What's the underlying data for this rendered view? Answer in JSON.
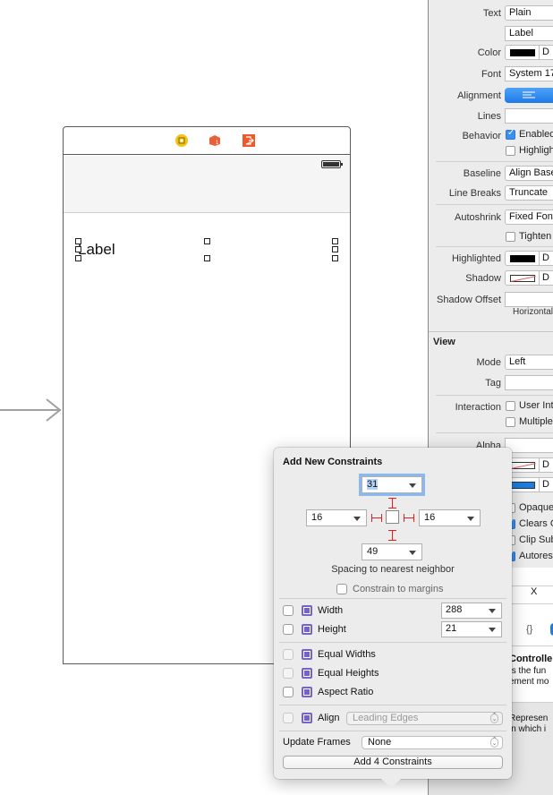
{
  "canvas": {
    "scene_label": "Label",
    "dock_icons": [
      "view-controller-icon",
      "first-responder-icon",
      "exit-icon"
    ],
    "colors": {
      "vc_icon": "#f3c316",
      "responder_icon": "#e8603a",
      "exit_icon": "#ee5b2b"
    }
  },
  "inspector": {
    "rows": [
      {
        "label": "Text",
        "value": "Plain"
      },
      {
        "label": "",
        "value": "Label"
      },
      {
        "label": "Color",
        "value": "D"
      },
      {
        "label": "Font",
        "value": "System 17"
      },
      {
        "label": "Alignment",
        "value": ""
      },
      {
        "label": "Lines",
        "value": ""
      },
      {
        "label": "Behavior",
        "value": "Enabled",
        "checked": true
      },
      {
        "label": "",
        "value": "Highlighted",
        "checked": false
      },
      {
        "label": "Baseline",
        "value": "Align Baselines"
      },
      {
        "label": "Line Breaks",
        "value": "Truncate"
      },
      {
        "label": "Autoshrink",
        "value": "Fixed Font"
      },
      {
        "label": "",
        "value": "Tighten",
        "checked": false
      },
      {
        "label": "Highlighted",
        "value": "D"
      },
      {
        "label": "Shadow",
        "value": "D"
      },
      {
        "label": "Shadow Offset",
        "value": ""
      },
      {
        "label": "",
        "value": "Horizontal"
      }
    ],
    "view_section": {
      "title": "View",
      "mode_label": "Mode",
      "mode_value": "Left",
      "tag_label": "Tag",
      "tag_value": "",
      "interaction_label": "Interaction",
      "user_interaction": "User Interaction Enabled",
      "multiple_touch": "Multiple Touch",
      "alpha_label": "Alpha",
      "bg_value": "D",
      "tint_value": "D",
      "opaque": "Opaque",
      "clears": "Clears Graphics Context",
      "clip": "Clip Subviews",
      "autoresize": "Autoresize Subviews"
    },
    "lower": {
      "x_label": "X",
      "braces": "{}",
      "controller_title": "Controller",
      "controller_line1": "ts the fun",
      "controller_line2": "ement mo",
      "represent_line1": "Represen",
      "represent_line2": "in which i",
      "represent_line3": "."
    }
  },
  "popover": {
    "title": "Add New Constraints",
    "top": "31",
    "left": "16",
    "right": "16",
    "bottom": "49",
    "spacing_label": "Spacing to nearest neighbor",
    "constrain_margins": "Constrain to margins",
    "width_label": "Width",
    "width_value": "288",
    "height_label": "Height",
    "height_value": "21",
    "equal_widths": "Equal Widths",
    "equal_heights": "Equal Heights",
    "aspect_ratio": "Aspect Ratio",
    "align_label": "Align",
    "align_value": "Leading Edges",
    "update_frames_label": "Update Frames",
    "update_frames_value": "None",
    "add_button": "Add 4 Constraints"
  }
}
